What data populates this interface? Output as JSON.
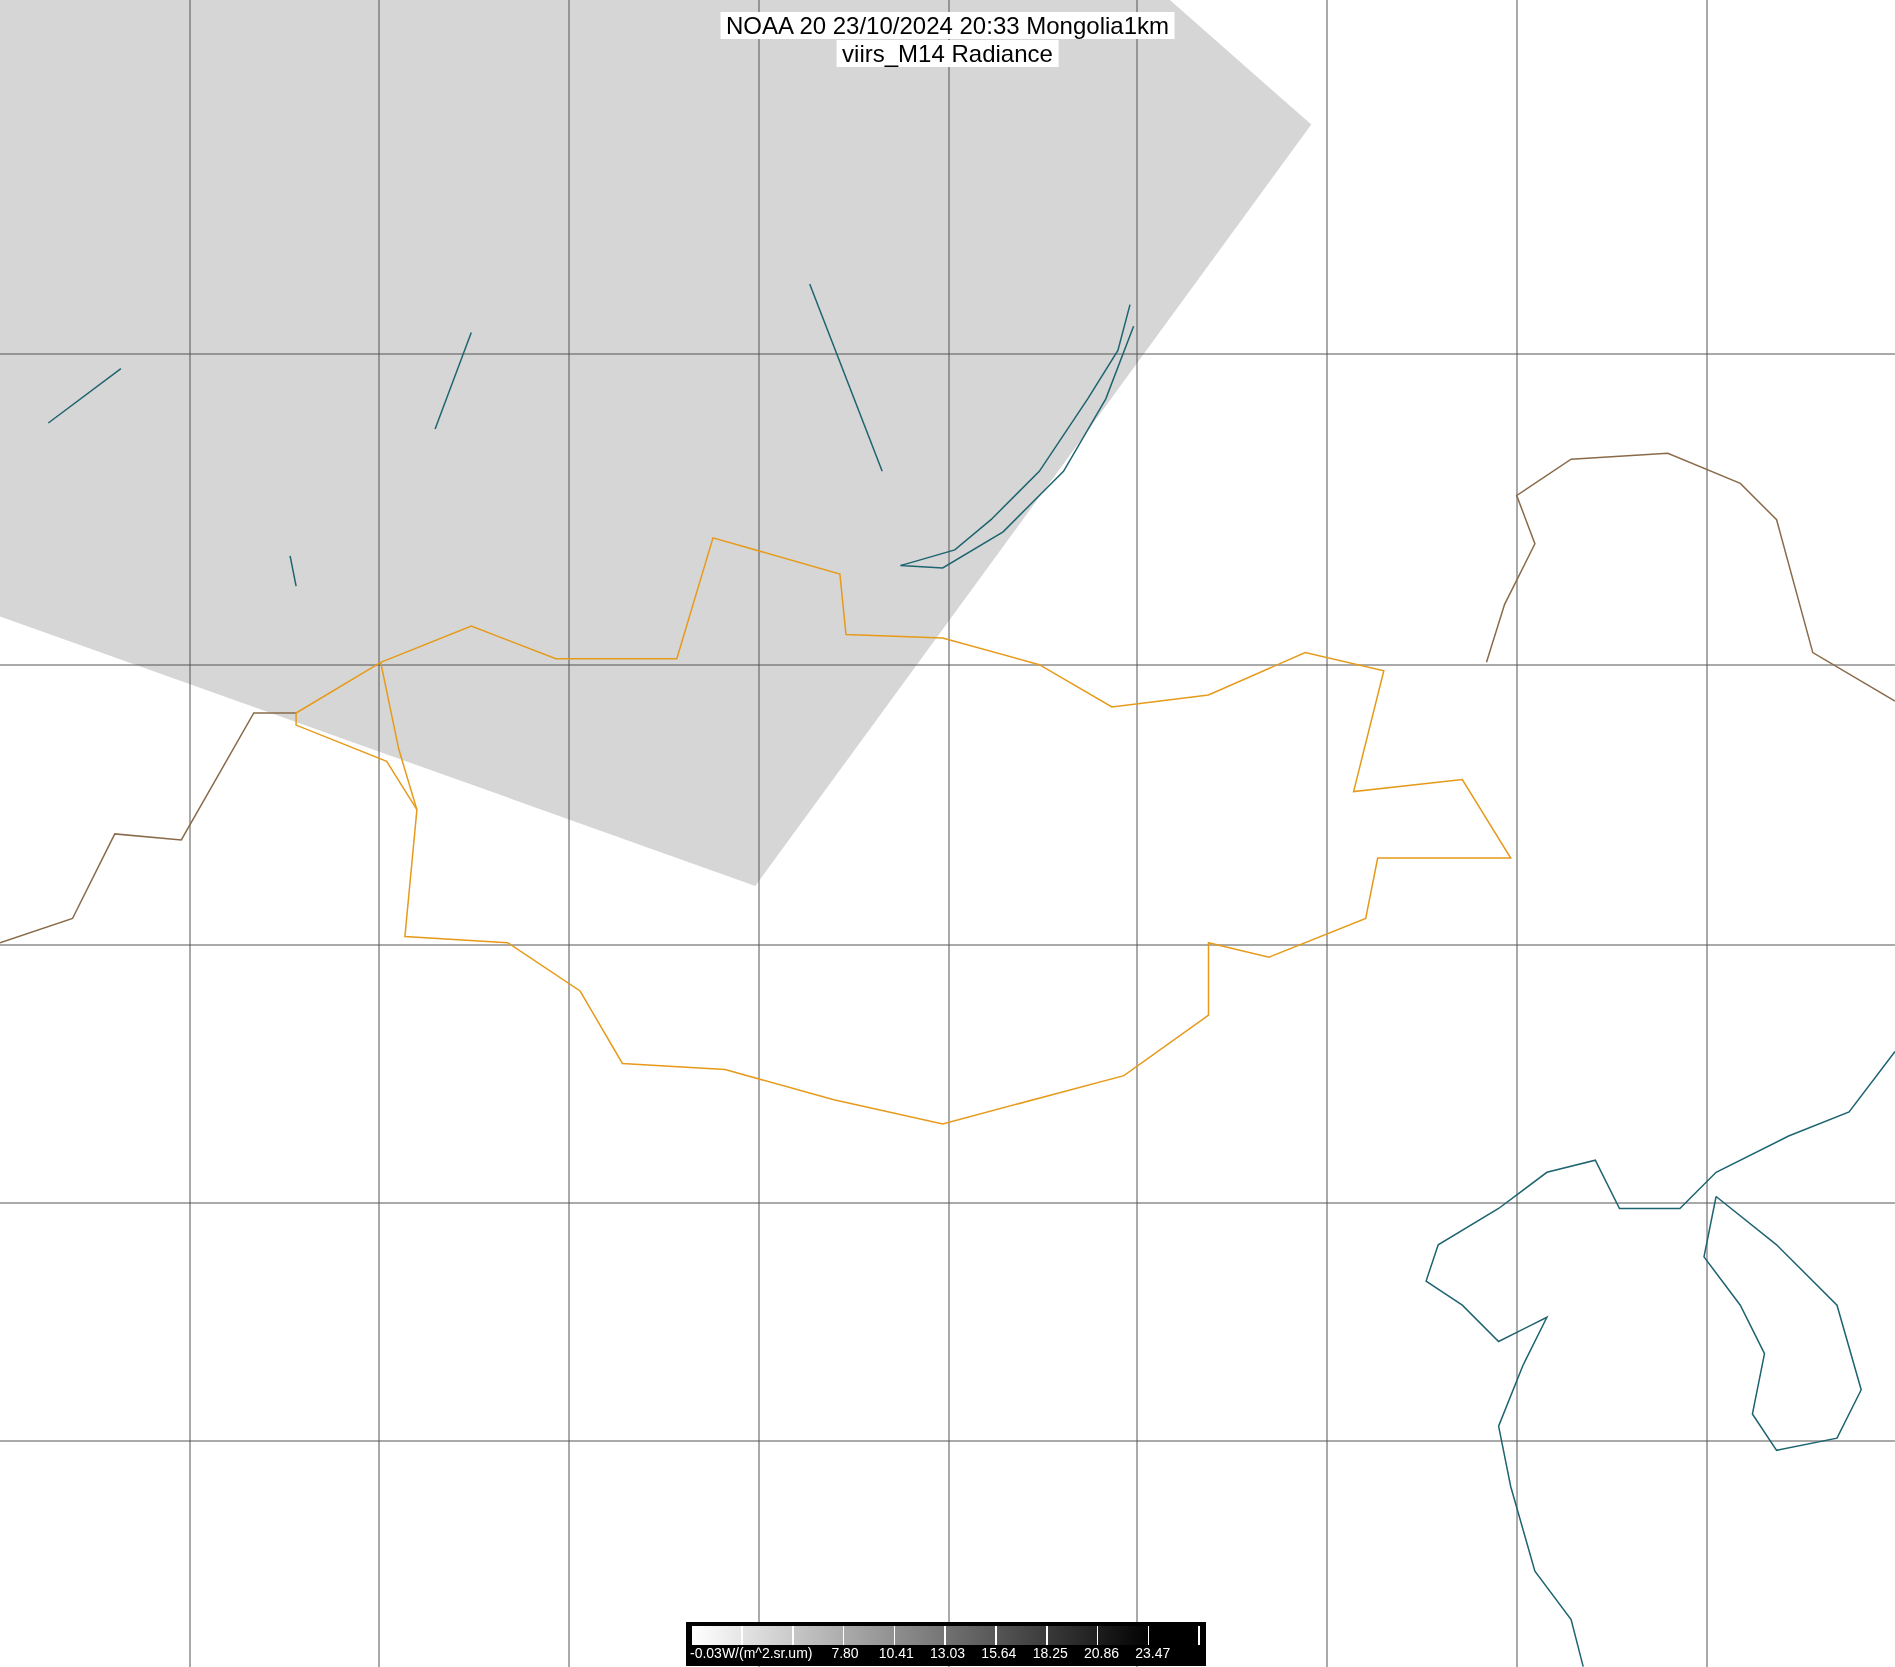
{
  "title": {
    "line_1": "NOAA 20 23/10/2024 20:33 Mongolia1km",
    "line_2": "viirs_M14 Radiance"
  },
  "colorbar": {
    "labels": [
      "-0.03W/(m^2.sr.um)",
      "7.80",
      "10.41",
      "13.03",
      "15.64",
      "18.25",
      "20.86",
      "23.47"
    ]
  }
}
